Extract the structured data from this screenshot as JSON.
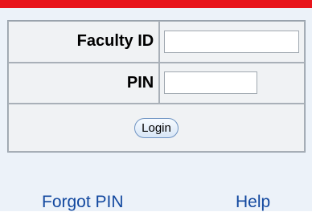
{
  "form": {
    "faculty_id_label": "Faculty ID",
    "faculty_id_value": "",
    "pin_label": "PIN",
    "pin_value": "",
    "login_button": "Login"
  },
  "links": {
    "forgot_pin": "Forgot PIN",
    "help": "Help"
  },
  "colors": {
    "top_bar": "#e8141b",
    "panel_background": "#ecf2f9",
    "link": "#12489f"
  }
}
